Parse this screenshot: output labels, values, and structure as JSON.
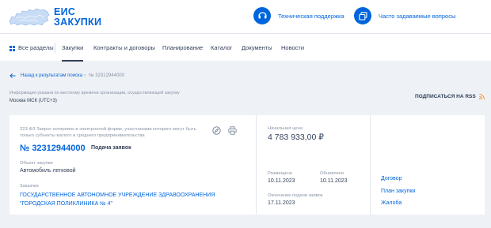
{
  "header": {
    "logo_line1": "ЕИС",
    "logo_line2": "ЗАКУПКИ",
    "support_label": "Техническая поддержка",
    "faq_label": "Часто задаваемые вопросы"
  },
  "nav": {
    "items": [
      {
        "label": "Все разделы",
        "icon": "grid-icon"
      },
      {
        "label": "Закупки",
        "active": true
      },
      {
        "label": "Контракты и договоры"
      },
      {
        "label": "Планирование"
      },
      {
        "label": "Каталог"
      },
      {
        "label": "Документы"
      },
      {
        "label": "Новости"
      }
    ]
  },
  "breadcrumb": {
    "back_label": "Назад к результатам поиска",
    "separator": "›",
    "current": "№ 32312944000"
  },
  "page": {
    "time_note": "Информация указана по местному времени организации, осуществляющей закупку",
    "timezone": "Москва МСК (UTC+3)",
    "subscribe_label": "ПОДПИСАТЬСЯ НА RSS"
  },
  "procurement": {
    "type": "223-ФЗ Запрос котировок в электронной форме, участниками которого могут быть только субъекты малого и среднего предпринимательства",
    "number": "№ 32312944000",
    "stage": "Подача заявок",
    "object_label": "Объект закупки",
    "object_value": "Автомобиль легковой",
    "customer_label": "Заказчик",
    "customer_line1": "ГОСУДАРСТВЕННОЕ АВТОНОМНОЕ УЧРЕЖДЕНИЕ ЗДРАВООХРАНЕНИЯ",
    "customer_line2": "\"ГОРОДСКАЯ ПОЛИКЛИНИКА № 4\"",
    "price_label": "Начальная цена",
    "price_value": "4 783 933,00 ₽",
    "placed_label": "Размещено",
    "placed_value": "10.11.2023",
    "updated_label": "Обновлено",
    "updated_value": "10.11.2023",
    "deadline_label": "Окончание подачи заявок",
    "deadline_value": "17.11.2023"
  },
  "side_links": [
    "Договор",
    "План закупки",
    "Жалоба"
  ],
  "colors": {
    "brand_blue": "#0065dd",
    "text_dark": "#334059",
    "text_muted": "#8a94a6",
    "page_bg": "#eef1f5"
  }
}
